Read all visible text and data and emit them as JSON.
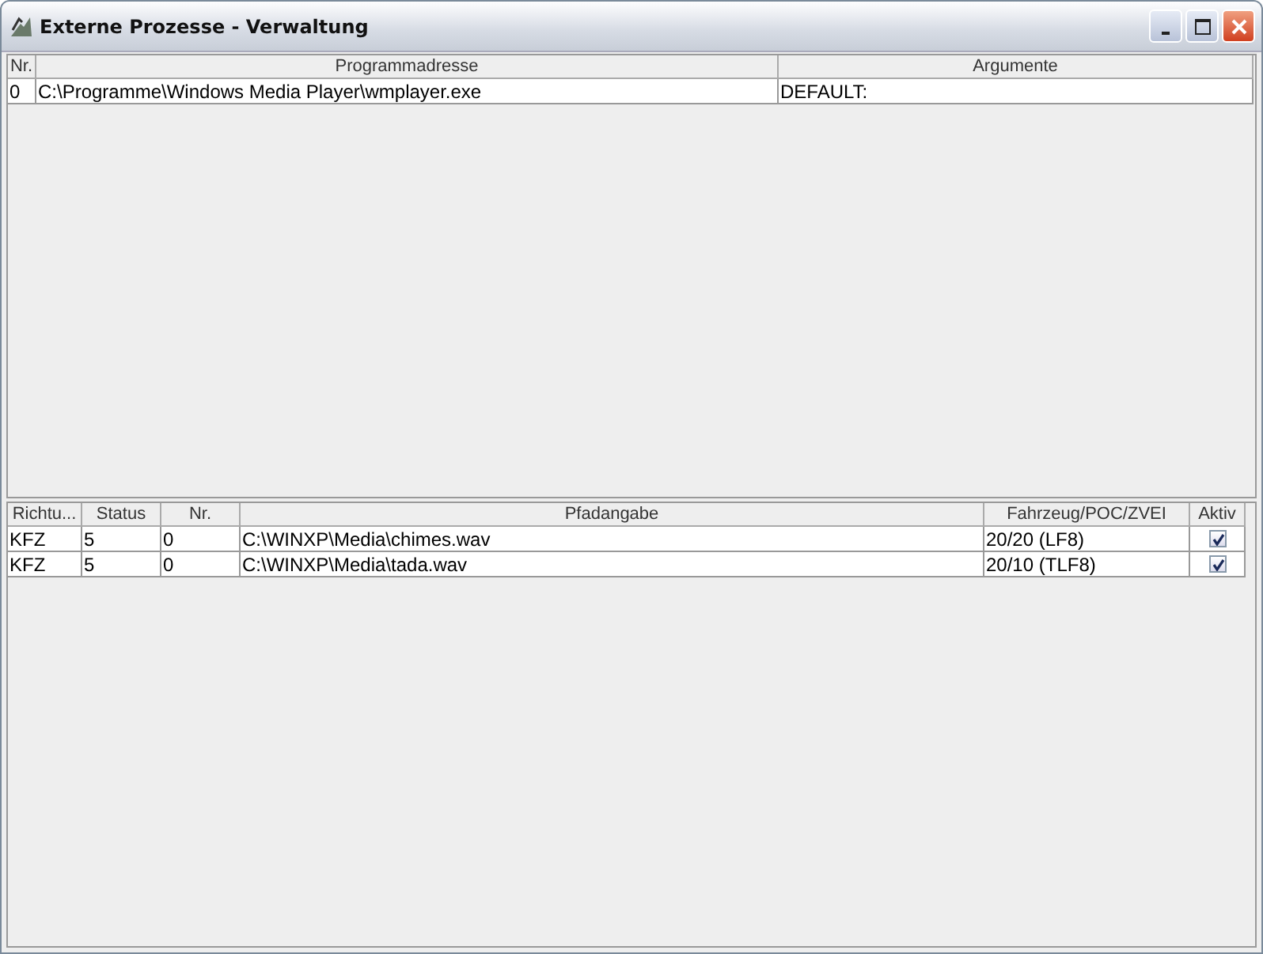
{
  "window": {
    "title": "Externe Prozesse - Verwaltung"
  },
  "programs": {
    "columns": [
      "Nr.",
      "Programmadresse",
      "Argumente"
    ],
    "rows": [
      {
        "cells": [
          "0",
          "C:\\Programme\\Windows Media Player\\wmplayer.exe",
          "DEFAULT:"
        ]
      }
    ]
  },
  "sounds": {
    "columns": [
      "Richtu...",
      "Status",
      "Nr.",
      "Pfadangabe",
      "Fahrzeug/POC/ZVEI",
      "Aktiv"
    ],
    "rows": [
      {
        "cells": [
          "KFZ",
          "5",
          "0",
          "C:\\WINXP\\Media\\chimes.wav",
          "20/20 (LF8)"
        ],
        "checked": true
      },
      {
        "cells": [
          "KFZ",
          "5",
          "0",
          "C:\\WINXP\\Media\\tada.wav",
          "20/10 (TLF8)"
        ],
        "checked": true
      }
    ]
  }
}
